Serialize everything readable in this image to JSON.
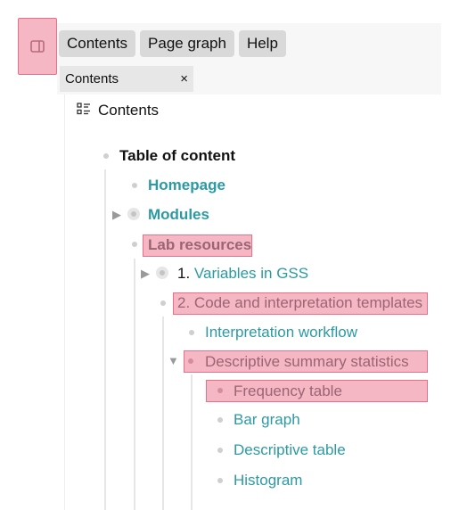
{
  "sidebar_toggle": {
    "icon": "panel-icon"
  },
  "tabs": [
    "Contents",
    "Page graph",
    "Help"
  ],
  "panel_tab": {
    "label": "Contents",
    "close": "×"
  },
  "outline": {
    "header": "Contents",
    "root": "Table of content",
    "items": {
      "homepage": "Homepage",
      "modules": "Modules",
      "lab_resources": "Lab resources",
      "variables_num": "1.",
      "variables": "Variables in GSS",
      "code_templates_num": "2.",
      "code_templates": "Code and interpretation templates",
      "interpretation_workflow": "Interpretation workflow",
      "descriptive_summary": "Descriptive summary statistics",
      "frequency_table": "Frequency table",
      "bar_graph": "Bar graph",
      "descriptive_table": "Descriptive table",
      "histogram": "Histogram"
    }
  },
  "colors": {
    "link": "#2b9aa3",
    "highlight": "#f6b7c4",
    "highlight_border": "#ea6f89"
  }
}
